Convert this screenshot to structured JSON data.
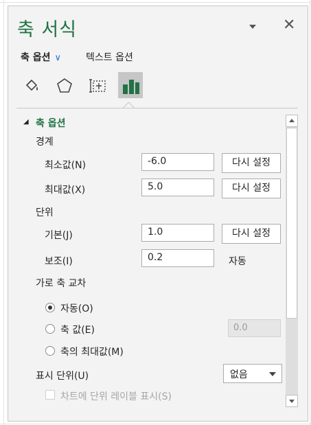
{
  "pane": {
    "title": "축 서식",
    "tabs": {
      "axis_options": "축 옵션",
      "text_options": "텍스트 옵션"
    },
    "icons": [
      "fill-line-icon",
      "effects-icon",
      "size-properties-icon",
      "axis-options-icon"
    ]
  },
  "axis_options": {
    "section_title": "축 옵션",
    "bounds_heading": "경계",
    "minimum": {
      "label": "최소값(N)",
      "value": "-6.0",
      "reset": "다시 설정"
    },
    "maximum": {
      "label": "최대값(X)",
      "value": "5.0",
      "reset": "다시 설정"
    },
    "units_heading": "단위",
    "major": {
      "label": "기본(J)",
      "value": "1.0",
      "reset": "다시 설정"
    },
    "minor": {
      "label": "보조(I)",
      "value": "0.2",
      "state": "자동"
    },
    "crosses_heading": "가로 축 교차",
    "crosses": {
      "auto": "자동(O)",
      "axis_value": "축 값(E)",
      "axis_value_input": "0.0",
      "max": "축의 최대값(M)",
      "selected": "auto"
    },
    "display_units": {
      "label": "표시 단위(U)",
      "value": "없음"
    },
    "show_label": "차트에 단위 레이블 표시(S)"
  },
  "colors": {
    "accent": "#217346",
    "chevron": "#1e6fd0"
  }
}
